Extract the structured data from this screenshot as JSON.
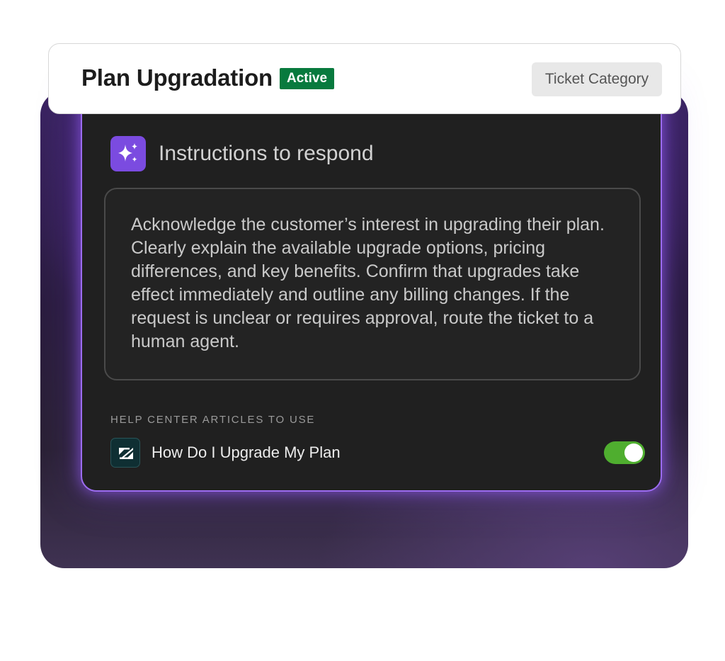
{
  "header": {
    "title": "Plan Upgradation",
    "status": "Active",
    "category": "Ticket Category",
    "status_color": "#087a3e"
  },
  "instructions": {
    "icon": "sparkle-icon",
    "title": "Instructions to respond",
    "text": "Acknowledge the customer’s interest in upgrading their plan. Clearly explain the available upgrade options, pricing differences, and key benefits. Confirm that upgrades take effect immediately and outline any billing changes. If the request is unclear or requires approval, route the ticket to a human agent."
  },
  "articles": {
    "heading": "HELP CENTER ARTICLES TO USE",
    "items": [
      {
        "icon": "zendesk-logo-icon",
        "title": "How Do I Upgrade My Plan",
        "enabled": true
      }
    ]
  },
  "colors": {
    "accent_purple": "#7b4be0",
    "card_border": "#9c6cf0",
    "toggle_on": "#4fae2f"
  }
}
